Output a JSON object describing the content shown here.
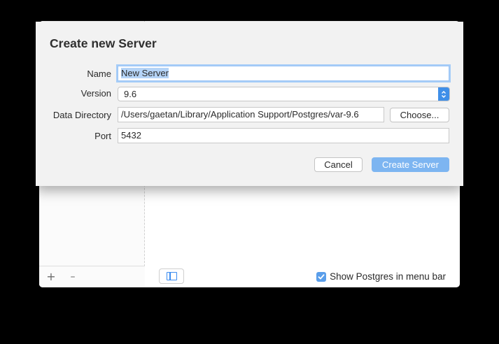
{
  "dialog": {
    "title": "Create new Server",
    "name_label": "Name",
    "name_value": "New Server",
    "version_label": "Version",
    "version_value": "9.6",
    "data_dir_label": "Data Directory",
    "data_dir_value": "/Users/gaetan/Library/Application Support/Postgres/var-9.6",
    "choose_label": "Choose...",
    "port_label": "Port",
    "port_value": "5432",
    "cancel_label": "Cancel",
    "create_label": "Create Server"
  },
  "window": {
    "show_in_menubar_label": "Show Postgres in menu bar",
    "show_in_menubar_checked": true,
    "add_icon": "+",
    "remove_icon": "–"
  },
  "colors": {
    "accent": "#3f8fe8",
    "primary_disabled": "#7db5f1"
  }
}
